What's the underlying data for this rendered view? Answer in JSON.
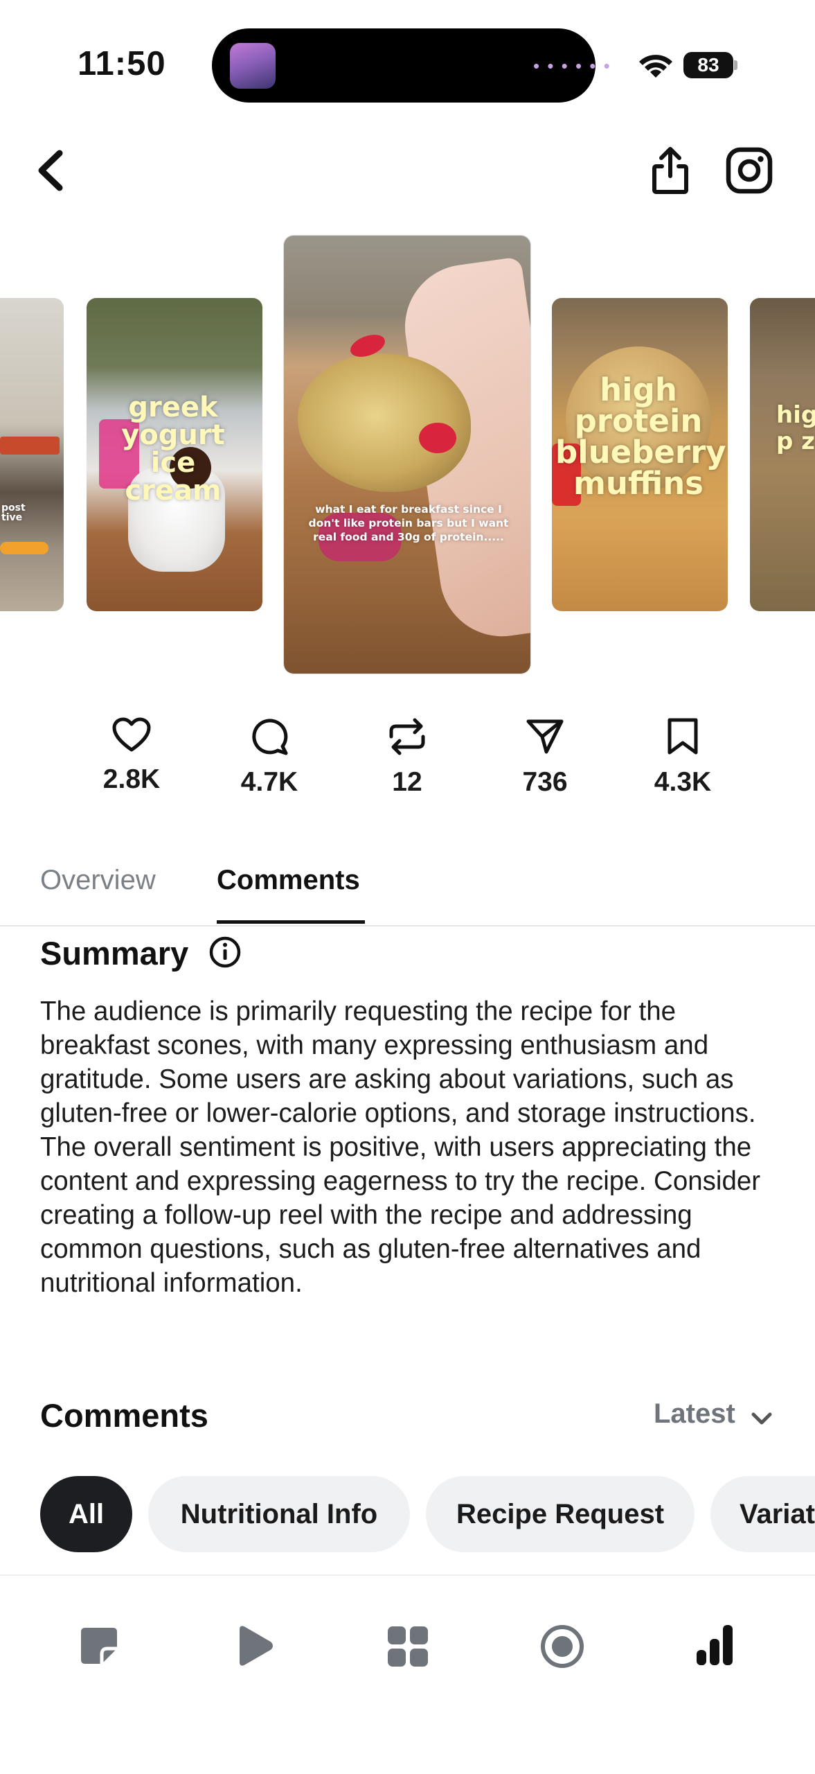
{
  "status_bar": {
    "time": "11:50",
    "battery": "83"
  },
  "carousel": {
    "items": [
      {
        "id": "left-partial",
        "overlay": "post\ntive"
      },
      {
        "id": "greek-yogurt",
        "overlay": "greek yogurt ice cream"
      },
      {
        "id": "selected",
        "overlay": "what I eat for breakfast since I don't like protein bars but I want real food and 30g of protein....."
      },
      {
        "id": "blueberry-muffins",
        "overlay": "high protein blueberry muffins"
      },
      {
        "id": "right-partial",
        "overlay": "high p z"
      }
    ]
  },
  "stats": {
    "likes": "2.8K",
    "comments": "4.7K",
    "reposts": "12",
    "shares": "736",
    "saves": "4.3K"
  },
  "tabs": {
    "overview": "Overview",
    "comments": "Comments"
  },
  "summary": {
    "title": "Summary",
    "body": "The audience is primarily requesting the recipe for the breakfast scones, with many expressing enthusiasm and gratitude. Some users are asking about variations, such as gluten-free or lower-calorie options, and storage instructions. The overall sentiment is positive, with users appreciating the content and expressing eagerness to try the recipe. Consider creating a follow-up reel with the recipe and addressing common questions, such as gluten-free alternatives and nutritional information."
  },
  "comments_section": {
    "title": "Comments",
    "sort_label": "Latest",
    "filters": [
      "All",
      "Nutritional Info",
      "Recipe Request",
      "Variat"
    ]
  },
  "bottom_nav": [
    "posts-icon",
    "reels-icon",
    "apps-grid-icon",
    "record-icon",
    "insights-icon"
  ],
  "colors": {
    "accent_dark": "#1c1e22",
    "muted_text": "#7b7f86",
    "chip_bg": "#f0f1f3",
    "cookie_nail": "#d8243c",
    "overlay_yellow": "#fff8b8"
  }
}
